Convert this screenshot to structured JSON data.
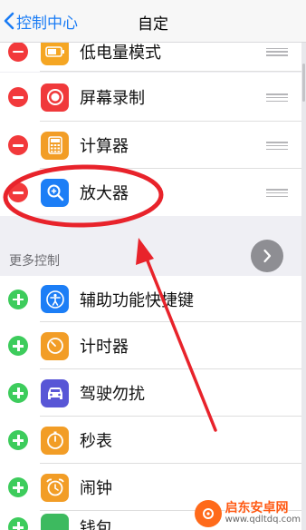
{
  "nav": {
    "back_label": "控制中心",
    "title": "自定"
  },
  "included": [
    {
      "label": "低电量模式",
      "icon": "battery-icon",
      "color": "#f5a623"
    },
    {
      "label": "屏幕录制",
      "icon": "screen-record-icon",
      "color": "#f0393b"
    },
    {
      "label": "计算器",
      "icon": "calculator-icon",
      "color": "#f29d26"
    },
    {
      "label": "放大器",
      "icon": "magnifier-icon",
      "color": "#1c7ef6"
    }
  ],
  "more_section": {
    "header": "更多控制"
  },
  "more": [
    {
      "label": "辅助功能快捷键",
      "icon": "accessibility-icon",
      "color": "#1c7ef6"
    },
    {
      "label": "计时器",
      "icon": "timer-icon",
      "color": "#f29d26"
    },
    {
      "label": "驾驶勿扰",
      "icon": "car-icon",
      "color": "#5856d6"
    },
    {
      "label": "秒表",
      "icon": "stopwatch-icon",
      "color": "#f29d26"
    },
    {
      "label": "闹钟",
      "icon": "alarm-icon",
      "color": "#f29d26"
    },
    {
      "label": "钱包",
      "icon": "wallet-icon",
      "color": "#3dba5f"
    }
  ],
  "watermark": {
    "name": "启东安卓网",
    "url": "www.qdltdq.com"
  },
  "colors": {
    "annotation": "#e8232b",
    "remove": "#f2393b",
    "add": "#3dcc5c",
    "accent": "#1a7cf5"
  }
}
